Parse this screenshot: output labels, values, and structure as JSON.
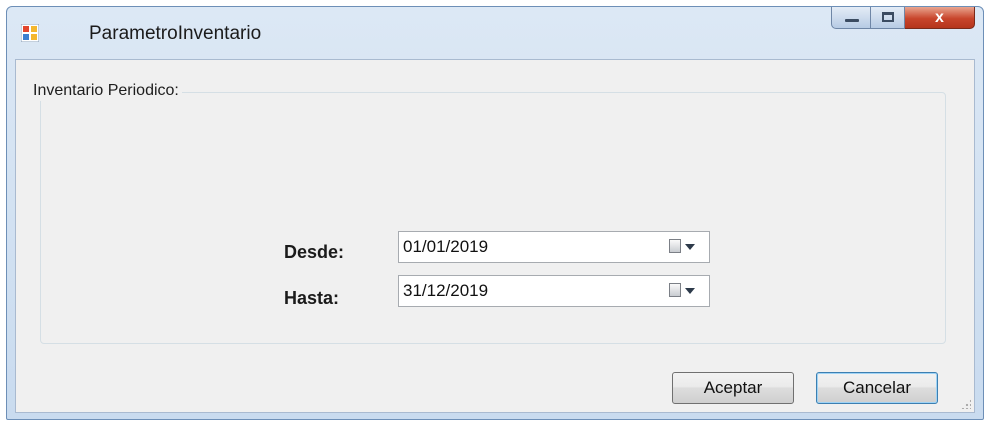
{
  "window": {
    "title": "ParametroInventario",
    "icon": "form-app-icon",
    "controls": {
      "minimize": "minimize-icon",
      "maximize": "maximize-icon",
      "close": "x"
    }
  },
  "group": {
    "legend": "Inventario Periodico:"
  },
  "fields": {
    "desde": {
      "label": "Desde:",
      "value": "01/01/2019",
      "icon": "calendar-dropdown-icon"
    },
    "hasta": {
      "label": "Hasta:",
      "value": "31/12/2019",
      "icon": "calendar-dropdown-icon"
    }
  },
  "buttons": {
    "accept": "Aceptar",
    "cancel": "Cancelar"
  },
  "colors": {
    "client_background": "#f0f0f0",
    "titlebar": "#c9dbef",
    "close_button": "#c8452c",
    "default_button_border": "#3c7fb1"
  }
}
